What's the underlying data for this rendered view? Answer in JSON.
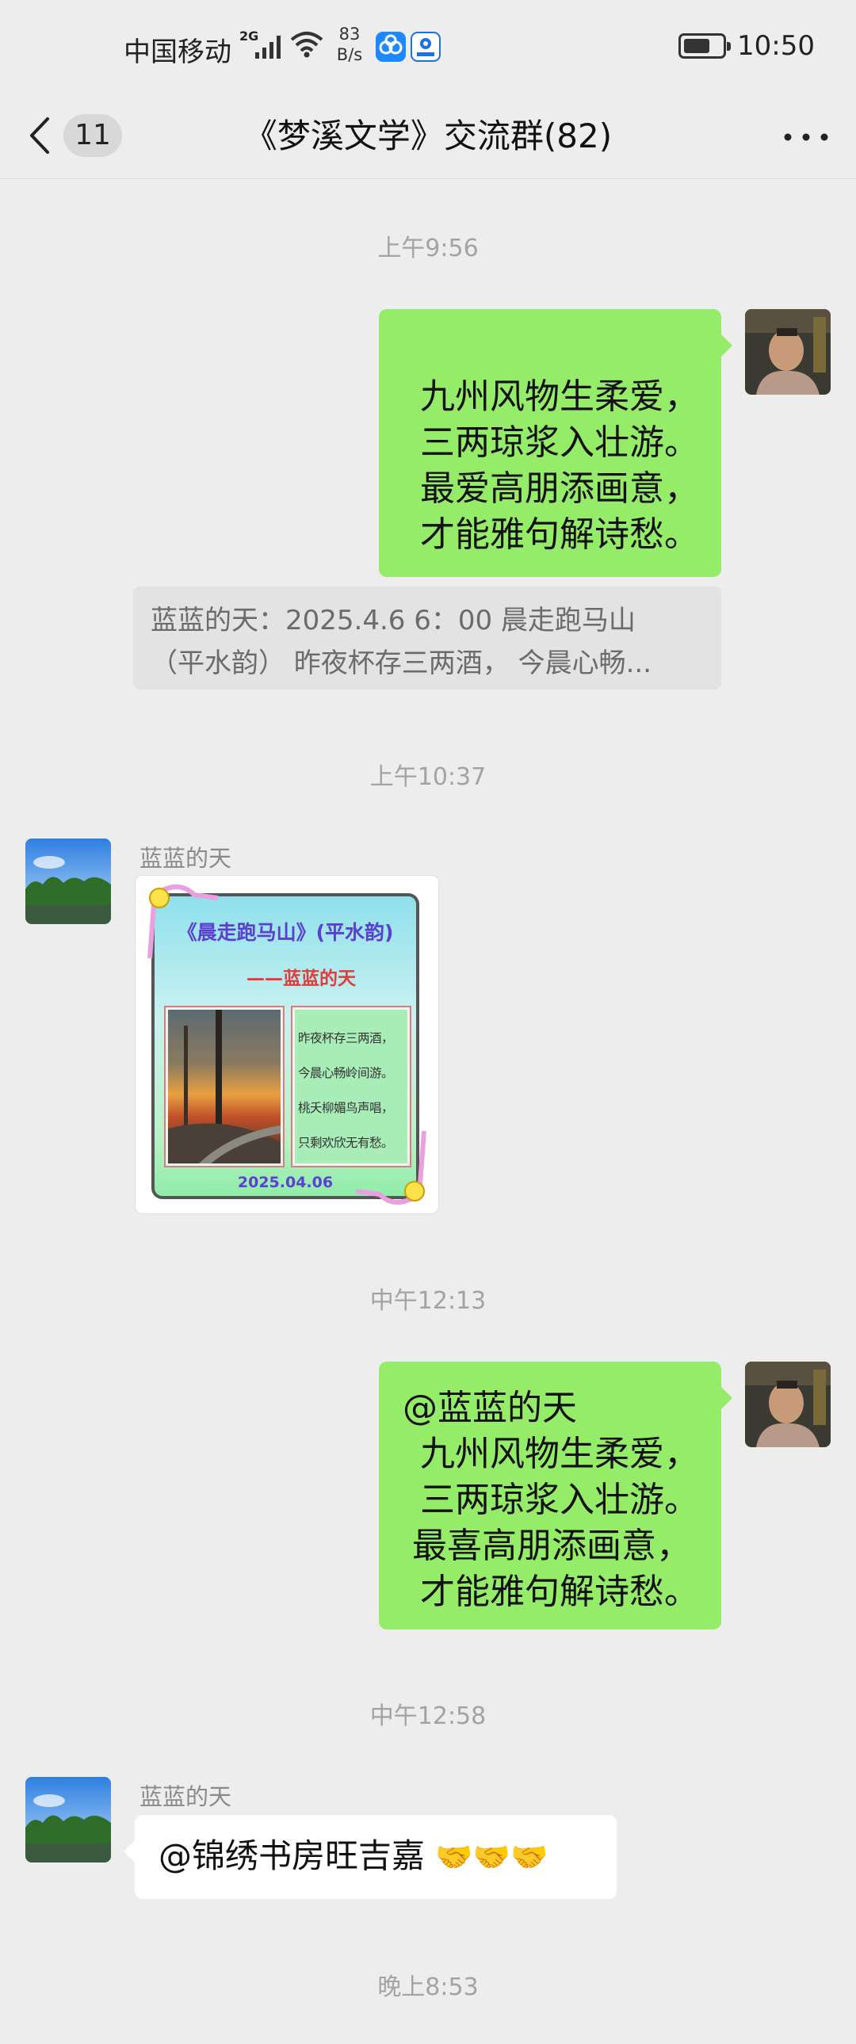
{
  "status_bar": {
    "carrier": "中国移动",
    "network": "2G",
    "speed_value": "83",
    "speed_unit": "B/s",
    "time": "10:50",
    "battery_level": 0.6
  },
  "header": {
    "back_count": "11",
    "title": "《梦溪文学》交流群(82)"
  },
  "messages": {
    "ts1": "上午9:56",
    "msg1_lines": [
      "九州风物生柔爱，",
      "三两琼浆入壮游。",
      "最爱高朋添画意，",
      "才能雅句解诗愁。"
    ],
    "quote_line1": "蓝蓝的天：2025.4.6  6：00 晨走跑马山",
    "quote_line2": "（平水韵） 昨夜杯存三两酒，  今晨心畅...",
    "ts2": "上午10:37",
    "sender2": "蓝蓝的天",
    "card": {
      "title": "《晨走跑马山》(平水韵)",
      "author": "——蓝蓝的天",
      "poem_lines": [
        "昨夜杯存三两酒，",
        "今晨心畅岭间游。",
        "桃夭柳媚鸟声唱，",
        "只剩欢欣无有愁。"
      ],
      "date": "2025.04.06"
    },
    "ts3": "中午12:13",
    "msg3_mention": "@蓝蓝的天",
    "msg3_lines": [
      "九州风物生柔爱，",
      "三两琼浆入壮游。",
      "最喜高朋添画意，",
      "才能雅句解诗愁。"
    ],
    "ts4": "中午12:58",
    "sender4": "蓝蓝的天",
    "msg4_text": "@锦绣书房旺吉嘉 ",
    "msg4_emoji": "🤝🤝🤝",
    "ts5": "晚上8:53"
  }
}
